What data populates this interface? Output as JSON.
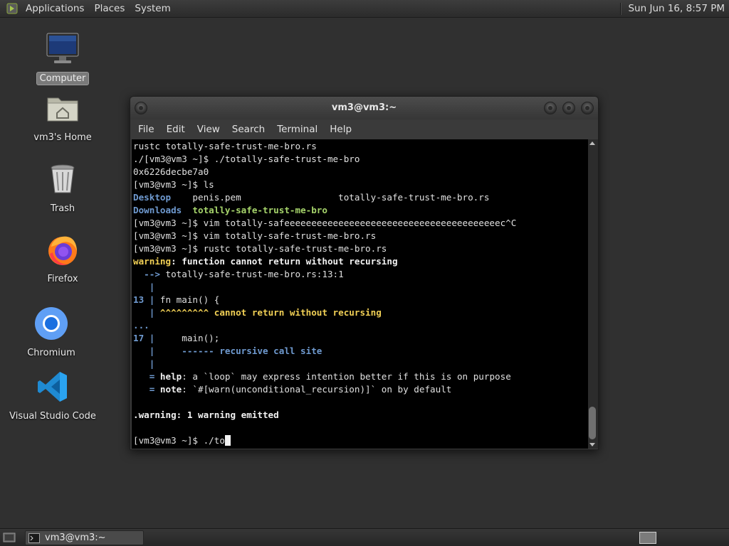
{
  "top_panel": {
    "menus": [
      "Applications",
      "Places",
      "System"
    ],
    "clock": "Sun Jun 16,  8:57 PM"
  },
  "desktop_icons": [
    {
      "label": "Computer",
      "icon": "computer-icon"
    },
    {
      "label": "vm3's Home",
      "icon": "home-folder-icon"
    },
    {
      "label": "Trash",
      "icon": "trash-icon"
    },
    {
      "label": "Firefox",
      "icon": "firefox-icon"
    },
    {
      "label": "Chromium",
      "icon": "chromium-icon"
    },
    {
      "label": "Visual Studio Code",
      "icon": "vscode-icon"
    }
  ],
  "terminal": {
    "title": "vm3@vm3:~",
    "menus": [
      "File",
      "Edit",
      "View",
      "Search",
      "Terminal",
      "Help"
    ],
    "lines": [
      [
        {
          "t": "rustc totally-safe-trust-me-bro.rs"
        }
      ],
      [
        {
          "t": "./[vm3@vm3 ~]$ ./totally-safe-trust-me-bro"
        }
      ],
      [
        {
          "t": "0x6226decbe7a0"
        }
      ],
      [
        {
          "t": "[vm3@vm3 ~]$ ls"
        }
      ],
      [
        {
          "t": "Desktop",
          "c": "blue"
        },
        {
          "t": "    penis.pem                  totally-safe-trust-me-bro.rs"
        }
      ],
      [
        {
          "t": "Downloads",
          "c": "blue"
        },
        {
          "t": "  "
        },
        {
          "t": "totally-safe-trust-me-bro",
          "c": "green"
        }
      ],
      [
        {
          "t": "[vm3@vm3 ~]$ vim totally-safeeeeeeeeeeeeeeeeeeeeeeeeeeeeeeeeeeeeeeeec^C"
        }
      ],
      [
        {
          "t": "[vm3@vm3 ~]$ vim totally-safe-trust-me-bro.rs"
        }
      ],
      [
        {
          "t": "[vm3@vm3 ~]$ rustc totally-safe-trust-me-bro.rs"
        }
      ],
      [
        {
          "t": "warning",
          "c": "yel"
        },
        {
          "t": ": function cannot return without recursing",
          "c": "white"
        }
      ],
      [
        {
          "t": "  --> ",
          "c": "blue"
        },
        {
          "t": "totally-safe-trust-me-bro.rs:13:1"
        }
      ],
      [
        {
          "t": "   |",
          "c": "blue"
        }
      ],
      [
        {
          "t": "13 |",
          "c": "blue"
        },
        {
          "t": " fn main() {"
        }
      ],
      [
        {
          "t": "   |",
          "c": "blue"
        },
        {
          "t": " ^^^^^^^^^ cannot return without recursing",
          "c": "yel"
        }
      ],
      [
        {
          "t": "...",
          "c": "blue"
        }
      ],
      [
        {
          "t": "17 |",
          "c": "blue"
        },
        {
          "t": "     main();"
        }
      ],
      [
        {
          "t": "   |",
          "c": "blue"
        },
        {
          "t": "     ------ recursive call site",
          "c": "blue"
        }
      ],
      [
        {
          "t": "   |",
          "c": "blue"
        }
      ],
      [
        {
          "t": "   = ",
          "c": "blue"
        },
        {
          "t": "help",
          "c": "white"
        },
        {
          "t": ": a `loop` may express intention better if this is on purpose"
        }
      ],
      [
        {
          "t": "   = ",
          "c": "blue"
        },
        {
          "t": "note",
          "c": "white"
        },
        {
          "t": ": `#[warn(unconditional_recursion)]` on by default"
        }
      ],
      [
        {
          "t": ""
        }
      ],
      [
        {
          "t": ".warning: 1 warning emitted",
          "c": "white"
        }
      ],
      [
        {
          "t": ""
        }
      ],
      [
        {
          "t": "[vm3@vm3 ~]$ ./to"
        }
      ]
    ]
  },
  "taskbar": {
    "task_label": "vm3@vm3:~"
  }
}
